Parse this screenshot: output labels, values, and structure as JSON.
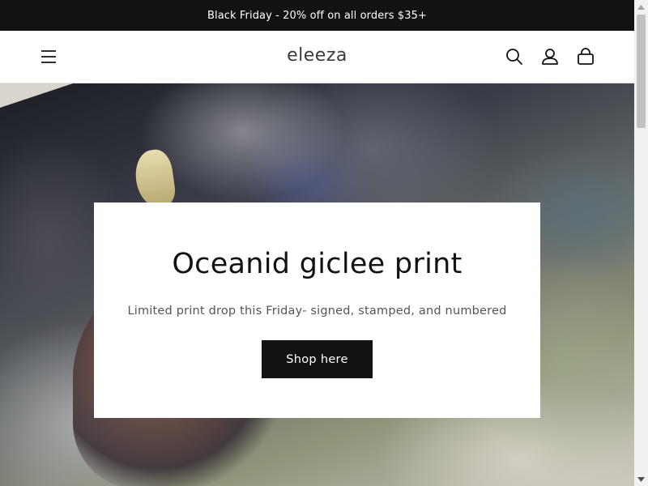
{
  "announcement": {
    "text": "Black Friday - 20% off on all orders $35+"
  },
  "header": {
    "logo": "eleeza",
    "icons": [
      "menu-icon",
      "search-icon",
      "account-icon",
      "cart-icon"
    ]
  },
  "hero": {
    "title": "Oceanid giclee print",
    "subtitle": "Limited print drop this Friday- signed, stamped, and numbered",
    "button_label": "Shop here"
  },
  "colors": {
    "announcement_bg": "#121212",
    "button_bg": "#121212",
    "text": "#121212"
  }
}
